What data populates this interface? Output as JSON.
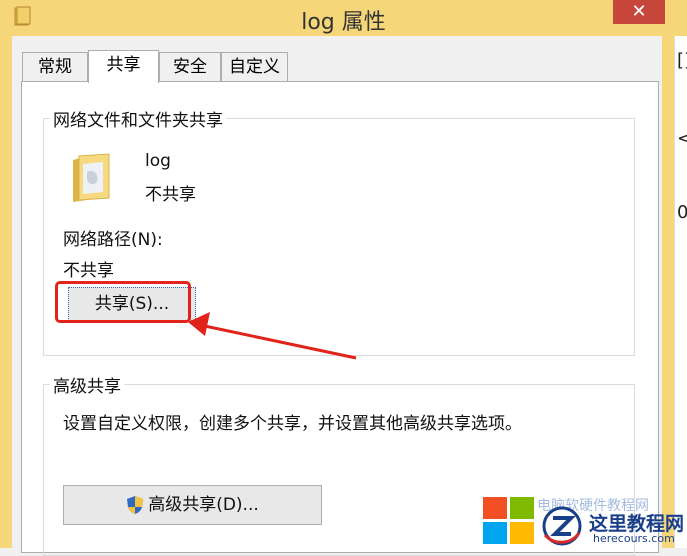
{
  "window": {
    "title": "log 属性",
    "close_glyph": "✕"
  },
  "tabs": [
    {
      "label": "常规"
    },
    {
      "label": "共享"
    },
    {
      "label": "安全"
    },
    {
      "label": "自定义"
    }
  ],
  "network_sharing": {
    "group_title": "网络文件和文件夹共享",
    "folder_name": "log",
    "status": "不共享",
    "path_label": "网络路径(N):",
    "path_value": "不共享",
    "share_button": "共享(S)..."
  },
  "advanced_sharing": {
    "group_title": "高级共享",
    "description": "设置自定义权限，创建多个共享，并设置其他高级共享选项。",
    "button": "高级共享(D)..."
  },
  "background_window": {
    "fragments": [
      "[]",
      "<a",
      "0"
    ]
  },
  "watermark": {
    "text": "这里教程网",
    "domain": "herecours.com",
    "faded": "电脑软硬件教程网"
  },
  "colors": {
    "title_bar": "#f5d77a",
    "close": "#c7463b",
    "highlight": "#e2231a"
  }
}
